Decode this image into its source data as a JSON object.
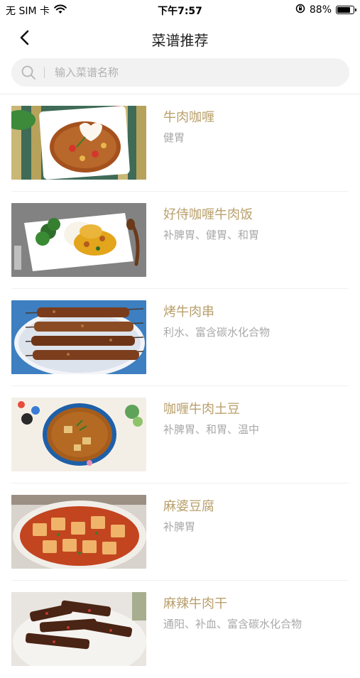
{
  "status_bar": {
    "carrier": "无 SIM 卡",
    "time": "下午7:57",
    "battery_percent": "88%",
    "battery_level": 0.88
  },
  "nav": {
    "title": "菜谱推荐",
    "back_icon": "chevron-left-icon"
  },
  "search": {
    "placeholder": "输入菜谱名称",
    "value": ""
  },
  "recipes": [
    {
      "name": "牛肉咖喱",
      "tags": "健胃",
      "image": "curry-beef-photo"
    },
    {
      "name": "好侍咖喱牛肉饭",
      "tags": "补脾胃、健胃、和胃",
      "image": "curry-rice-photo"
    },
    {
      "name": "烤牛肉串",
      "tags": "利水、富含碳水化合物",
      "image": "beef-skewers-photo"
    },
    {
      "name": "咖喱牛肉土豆",
      "tags": "补脾胃、和胃、温中",
      "image": "curry-potato-photo"
    },
    {
      "name": "麻婆豆腐",
      "tags": "补脾胃",
      "image": "mapo-tofu-photo"
    },
    {
      "name": "麻辣牛肉干",
      "tags": "通阳、补血、富含碳水化合物",
      "image": "spicy-jerky-photo"
    }
  ]
}
